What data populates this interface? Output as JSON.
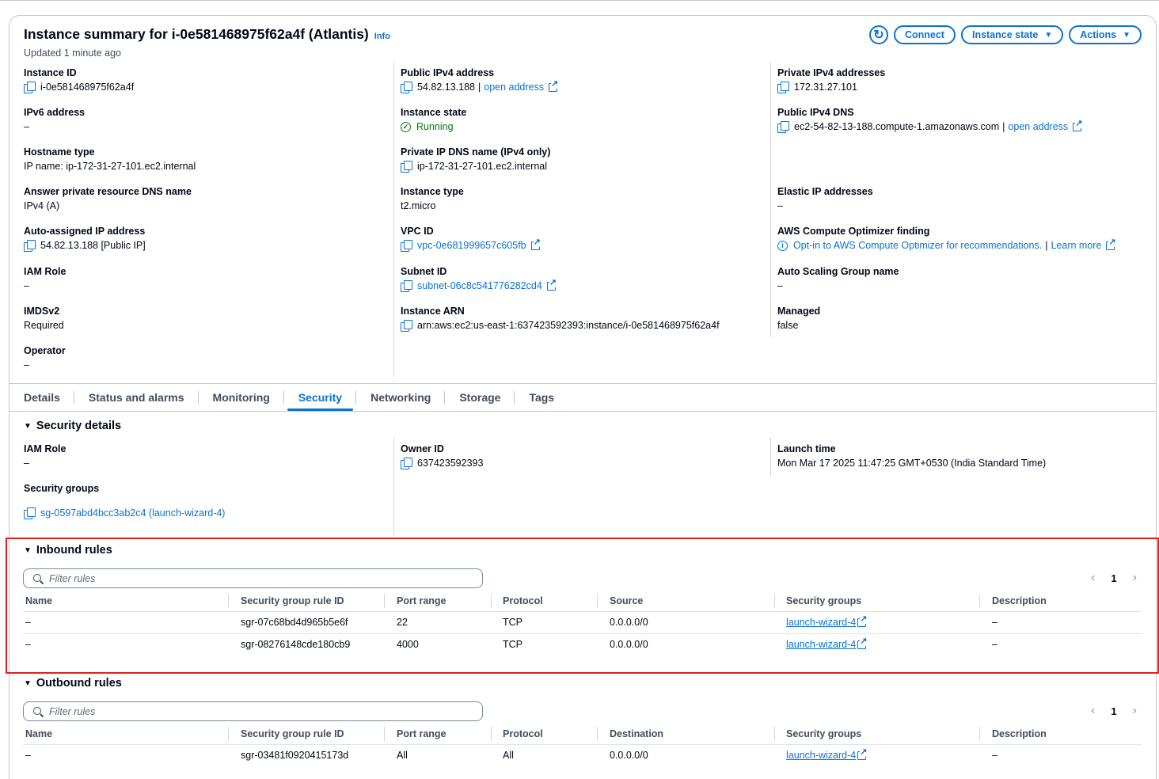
{
  "header": {
    "title": "Instance summary for i-0e581468975f62a4f (Atlantis)",
    "info": "Info",
    "updated": "Updated 1 minute ago",
    "buttons": {
      "connect": "Connect",
      "instance_state": "Instance state",
      "actions": "Actions"
    }
  },
  "summary": {
    "col1": [
      {
        "label": "Instance ID",
        "value": "i-0e581468975f62a4f"
      },
      {
        "label": "IPv6 address",
        "value": "–"
      },
      {
        "label": "Hostname type",
        "value": "IP name: ip-172-31-27-101.ec2.internal"
      },
      {
        "label": "Answer private resource DNS name",
        "value": "IPv4 (A)"
      },
      {
        "label": "Auto-assigned IP address",
        "value": "54.82.13.188 [Public IP]"
      },
      {
        "label": "IAM Role",
        "value": "–"
      },
      {
        "label": "IMDSv2",
        "value": "Required"
      },
      {
        "label": "Operator",
        "value": "–"
      }
    ],
    "col2": [
      {
        "label": "Public IPv4 address",
        "value": "54.82.13.188",
        "sep": "|",
        "link": "open address"
      },
      {
        "label": "Instance state",
        "value": "Running"
      },
      {
        "label": "Private IP DNS name (IPv4 only)",
        "value": "ip-172-31-27-101.ec2.internal"
      },
      {
        "label": "Instance type",
        "value": "t2.micro"
      },
      {
        "label": "VPC ID",
        "value": "vpc-0e681999657c605fb"
      },
      {
        "label": "Subnet ID",
        "value": "subnet-06c8c541776282cd4"
      },
      {
        "label": "Instance ARN",
        "value": "arn:aws:ec2:us-east-1:637423592393:instance/i-0e581468975f62a4f"
      }
    ],
    "col3": [
      {
        "label": "Private IPv4 addresses",
        "value": "172.31.27.101"
      },
      {
        "label": "Public IPv4 DNS",
        "value": "ec2-54-82-13-188.compute-1.amazonaws.com",
        "sep": "|",
        "link": "open address"
      },
      {
        "label": "Elastic IP addresses",
        "value": "–"
      },
      {
        "label": "AWS Compute Optimizer finding",
        "value": "Opt-in to AWS Compute Optimizer for recommendations.",
        "sep": "|",
        "link": "Learn more"
      },
      {
        "label": "Auto Scaling Group name",
        "value": "–"
      },
      {
        "label": "Managed",
        "value": "false"
      }
    ]
  },
  "tabs": [
    "Details",
    "Status and alarms",
    "Monitoring",
    "Security",
    "Networking",
    "Storage",
    "Tags"
  ],
  "security": {
    "heading": "Security details",
    "iam_label": "IAM Role",
    "iam_value": "–",
    "sg_label": "Security groups",
    "sg_value": "sg-0597abd4bcc3ab2c4 (launch-wizard-4)",
    "owner_label": "Owner ID",
    "owner_value": "637423592393",
    "launch_label": "Launch time",
    "launch_value": "Mon Mar 17 2025 11:47:25 GMT+0530 (India Standard Time)"
  },
  "inbound": {
    "heading": "Inbound rules",
    "placeholder": "Filter rules",
    "page": "1",
    "columns": [
      "Name",
      "Security group rule ID",
      "Port range",
      "Protocol",
      "Source",
      "Security groups",
      "Description"
    ],
    "rows": [
      [
        "–",
        "sgr-07c68bd4d965b5e6f",
        "22",
        "TCP",
        "0.0.0.0/0",
        "launch-wizard-4",
        "–"
      ],
      [
        "–",
        "sgr-08276148cde180cb9",
        "4000",
        "TCP",
        "0.0.0.0/0",
        "launch-wizard-4",
        "–"
      ]
    ]
  },
  "outbound": {
    "heading": "Outbound rules",
    "placeholder": "Filter rules",
    "page": "1",
    "columns": [
      "Name",
      "Security group rule ID",
      "Port range",
      "Protocol",
      "Destination",
      "Security groups",
      "Description"
    ],
    "rows": [
      [
        "–",
        "sgr-03481f0920415173d",
        "All",
        "All",
        "0.0.0.0/0",
        "launch-wizard-4",
        "–"
      ]
    ]
  },
  "colors": {
    "link": "#0972d3",
    "success": "#037f0c",
    "highlight": "#e02020"
  }
}
